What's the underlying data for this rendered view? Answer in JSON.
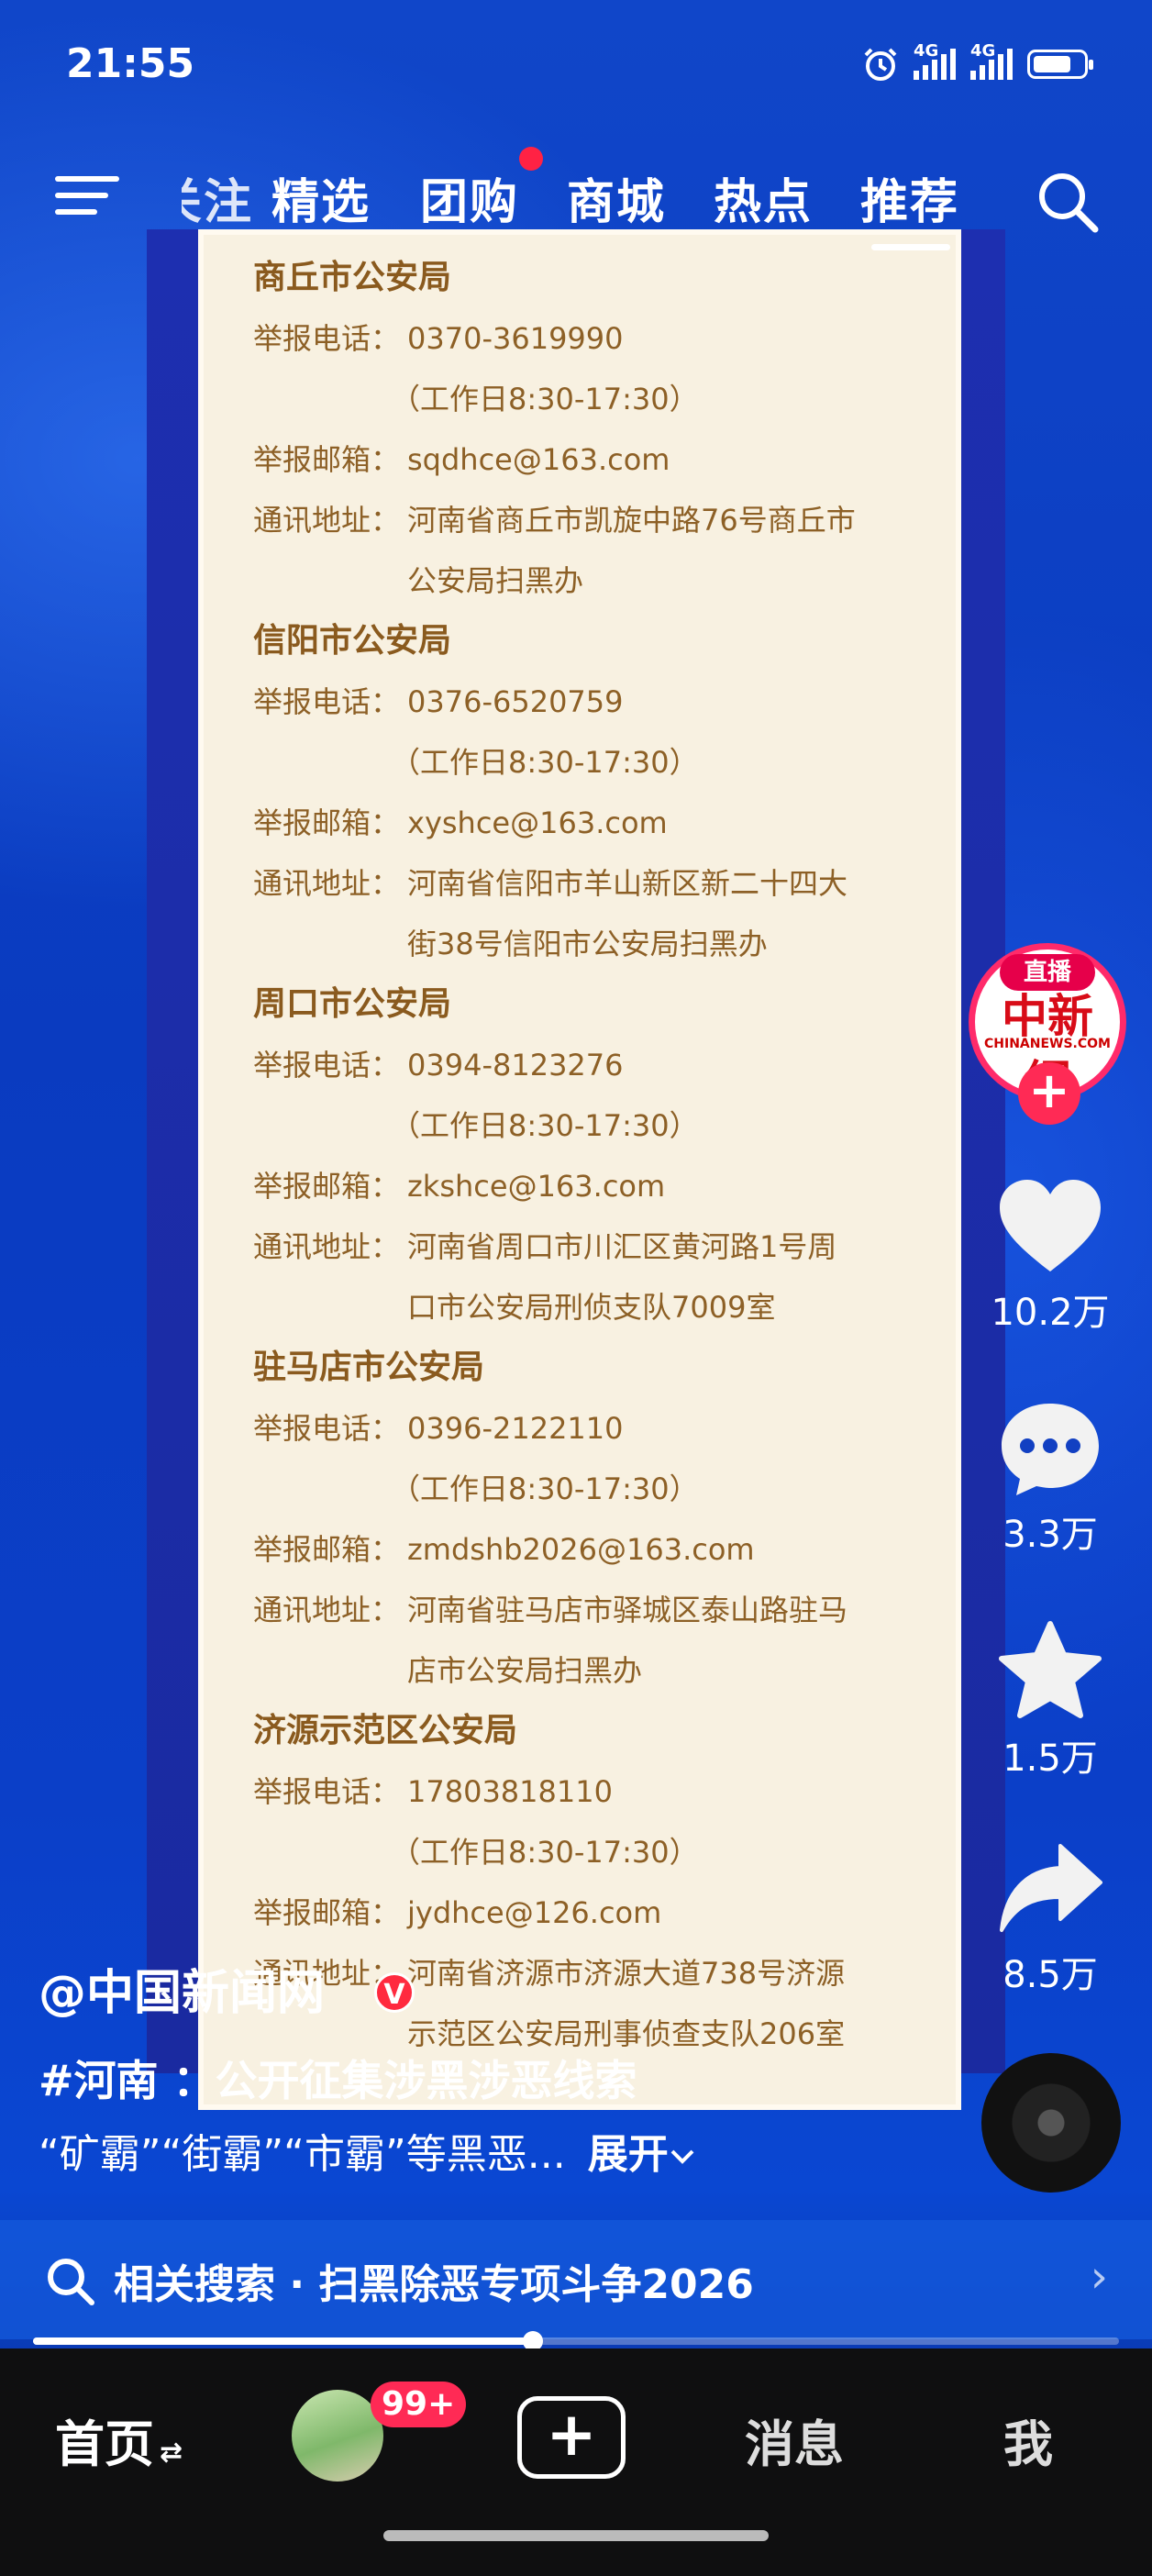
{
  "status_bar": {
    "time": "21:55",
    "net1": "4G",
    "net2": "4G"
  },
  "top_nav": {
    "tabs": [
      "关注",
      "精选",
      "团购",
      "商城",
      "热点",
      "推荐"
    ],
    "partial_tab": "注",
    "active": "推荐"
  },
  "document": {
    "sections": [
      {
        "title": "商丘市公安局",
        "phone_label": "举报电话：",
        "phone": "0370-3619990",
        "hours": "（工作日8:30-17:30）",
        "email_label": "举报邮箱：",
        "email": "sqdhce@163.com",
        "addr_label": "通讯地址：",
        "addr1": "河南省商丘市凯旋中路76号商丘市",
        "addr2": "公安局扫黑办"
      },
      {
        "title": "信阳市公安局",
        "phone_label": "举报电话：",
        "phone": "0376-6520759",
        "hours": "（工作日8:30-17:30）",
        "email_label": "举报邮箱：",
        "email": "xyshce@163.com",
        "addr_label": "通讯地址：",
        "addr1": "河南省信阳市羊山新区新二十四大",
        "addr2": "街38号信阳市公安局扫黑办"
      },
      {
        "title": "周口市公安局",
        "phone_label": "举报电话：",
        "phone": "0394-8123276",
        "hours": "（工作日8:30-17:30）",
        "email_label": "举报邮箱：",
        "email": "zkshce@163.com",
        "addr_label": "通讯地址：",
        "addr1": "河南省周口市川汇区黄河路1号周",
        "addr2": "口市公安局刑侦支队7009室"
      },
      {
        "title": "驻马店市公安局",
        "phone_label": "举报电话：",
        "phone": "0396-2122110",
        "hours": "（工作日8:30-17:30）",
        "email_label": "举报邮箱：",
        "email": "zmdshb2026@163.com",
        "addr_label": "通讯地址：",
        "addr1": "河南省驻马店市驿城区泰山路驻马",
        "addr2": "店市公安局扫黑办"
      },
      {
        "title": "济源示范区公安局",
        "phone_label": "举报电话：",
        "phone": "17803818110",
        "hours": "（工作日8:30-17:30）",
        "email_label": "举报邮箱：",
        "email": "jydhce@126.com",
        "addr_label": "通讯地址：",
        "addr1": "河南省济源市济源大道738号济源",
        "addr2": "示范区公安局刑事侦查支队206室"
      }
    ]
  },
  "creator": {
    "live_tag": "直播",
    "logo_text": "中新網",
    "logo_sub": "CHINANEWS.COM",
    "follow": "+"
  },
  "actions": {
    "likes": "10.2万",
    "comments": "3.3万",
    "favorites": "1.5万",
    "shares": "8.5万"
  },
  "caption": {
    "author": "@中国新闻网",
    "verified": "V",
    "line1": "#河南 ：公开征集涉黑涉恶线索",
    "line2": "“矿霸”“街霸”“市霸”等黑恶...",
    "expand": "展开"
  },
  "related_search": {
    "label": "相关搜索 · 扫黑除恶专项斗争2026"
  },
  "progress": {
    "value": 0.46
  },
  "bottom_nav": {
    "home": "首页",
    "badge": "99+",
    "messages": "消息",
    "me": "我"
  }
}
